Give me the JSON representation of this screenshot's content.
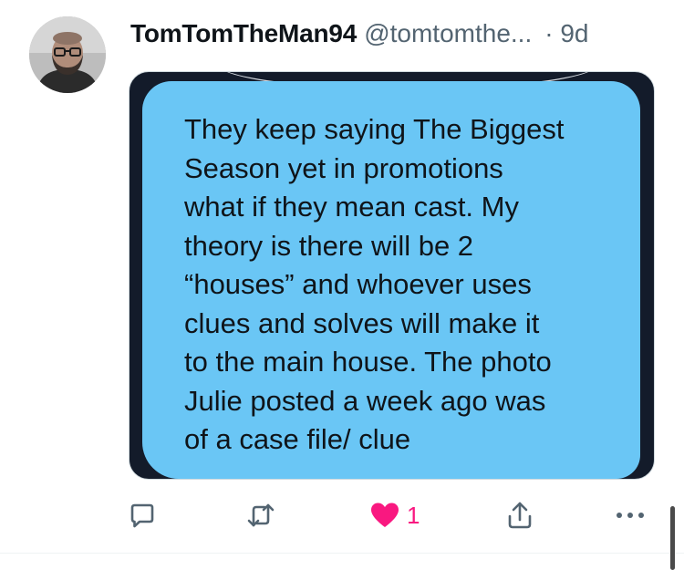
{
  "tweet": {
    "display_name": "TomTomTheMan94",
    "handle": "@tomtomthe...",
    "time": "· 9d",
    "image_text": "They keep saying The Biggest\nSeason yet in promotions\nwhat if they mean cast. My\ntheory is there will be 2\n“houses” and whoever uses\nclues and solves will make it\nto the main house. The photo\nJulie posted a week ago was\nof a case file/ clue"
  },
  "actions": {
    "like_count": "1",
    "icons": [
      "reply-icon",
      "retweet-icon",
      "heart-icon",
      "share-icon",
      "more-icon"
    ]
  },
  "colors": {
    "bubble": "#6ac6f5",
    "like": "#f91880",
    "muted": "#536471"
  }
}
